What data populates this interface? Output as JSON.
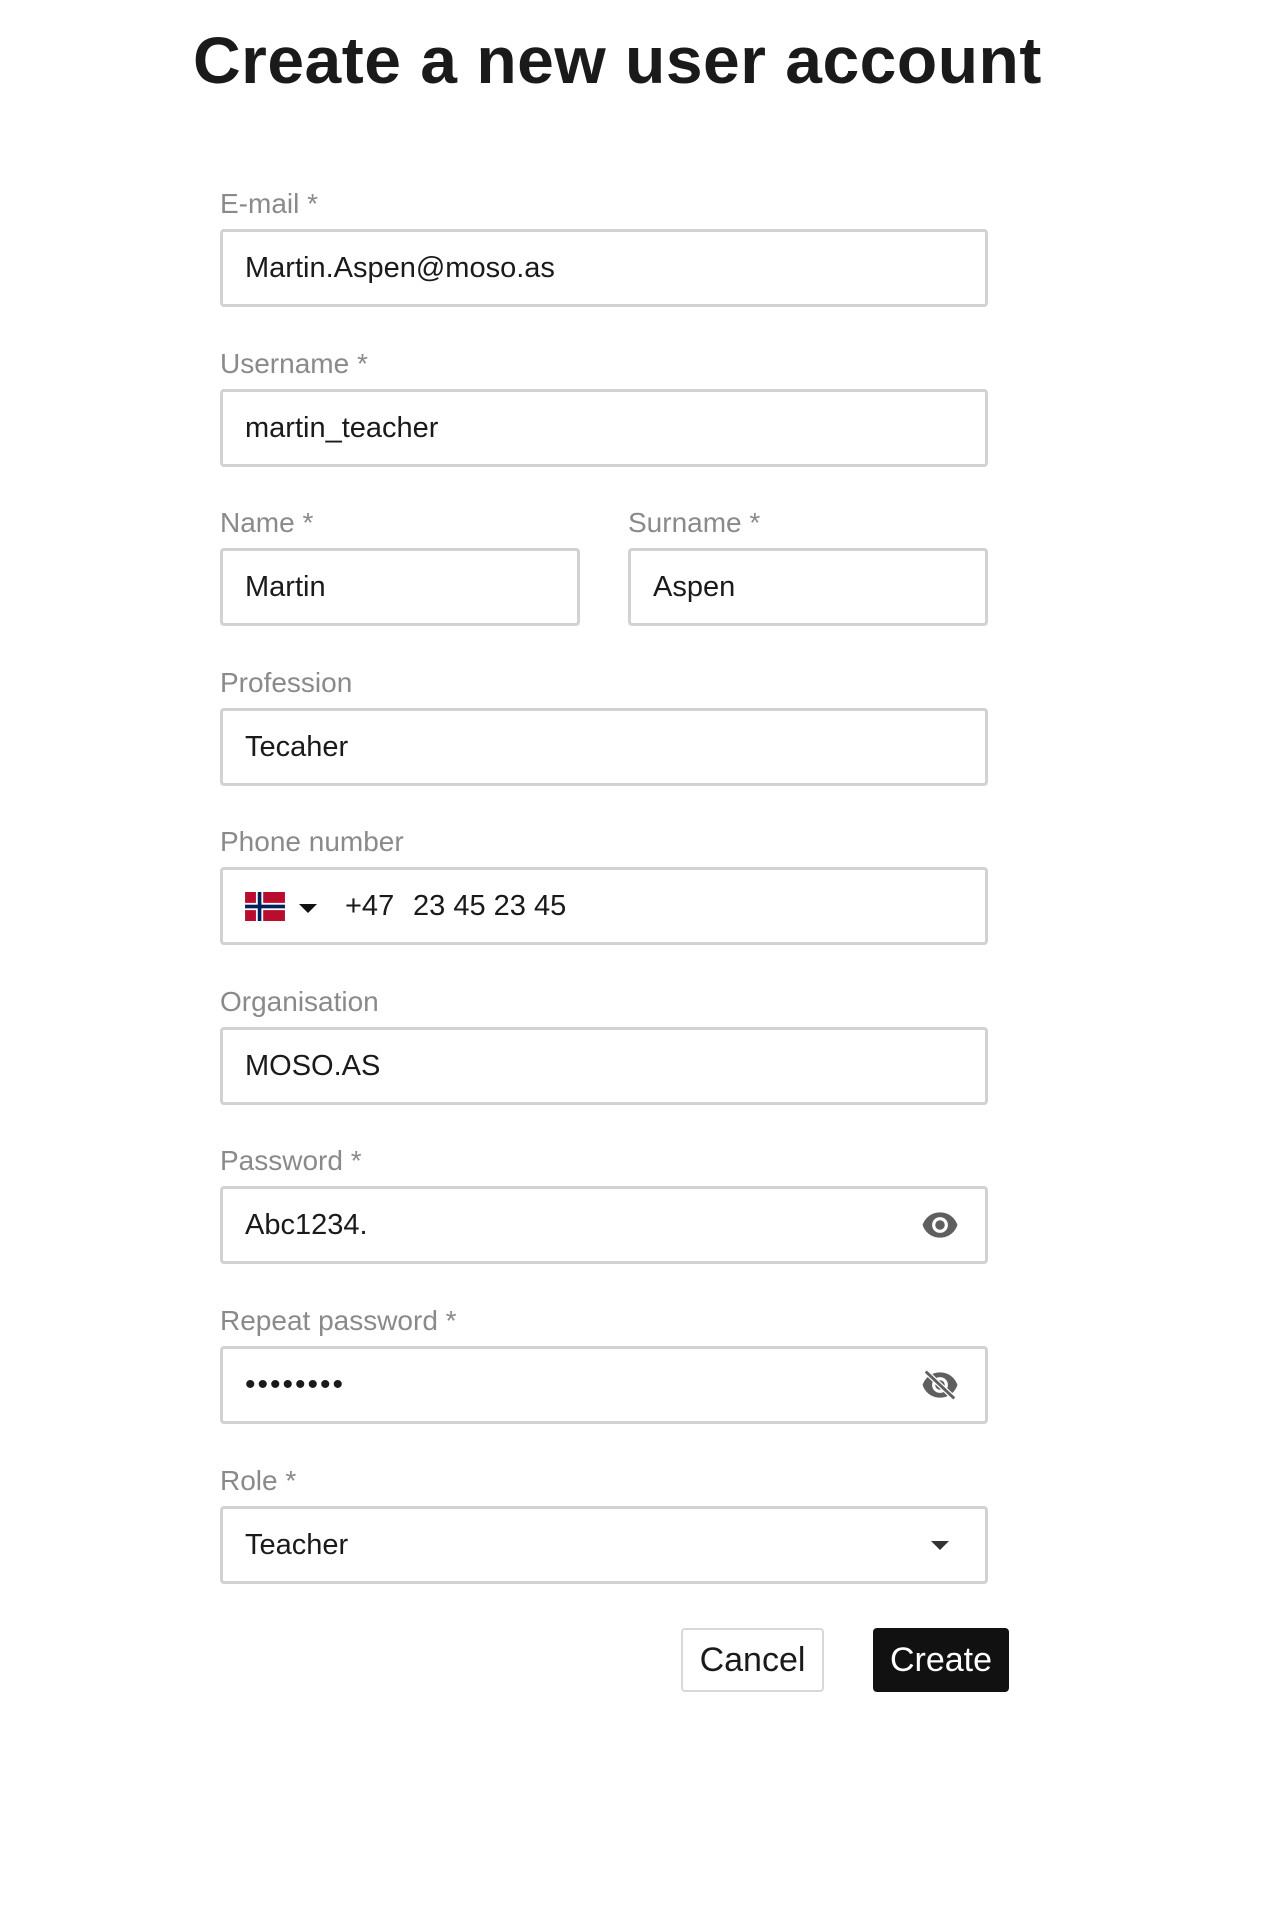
{
  "page": {
    "title": "Create a new user account"
  },
  "form": {
    "email": {
      "label": "E-mail *",
      "value": "Martin.Aspen@moso.as"
    },
    "username": {
      "label": "Username *",
      "value": "martin_teacher"
    },
    "name": {
      "label": "Name *",
      "value": "Martin"
    },
    "surname": {
      "label": "Surname *",
      "value": "Aspen"
    },
    "profession": {
      "label": "Profession",
      "value": "Tecaher"
    },
    "phone": {
      "label": "Phone number",
      "country_flag": "norway-flag-icon",
      "dial_code": "+47",
      "value": "23 45 23 45"
    },
    "organisation": {
      "label": "Organisation",
      "value": "MOSO.AS"
    },
    "password": {
      "label": "Password *",
      "value": "Abc1234.",
      "toggle_icon": "eye-icon"
    },
    "repeat_password": {
      "label": "Repeat password *",
      "masked_value": "••••••••",
      "toggle_icon": "eye-off-icon"
    },
    "role": {
      "label": "Role *",
      "selected": "Teacher"
    }
  },
  "actions": {
    "cancel_label": "Cancel",
    "create_label": "Create"
  },
  "colors": {
    "label": "#8a8a8a",
    "border": "#d2d2d2",
    "primary_button": "#111111",
    "flag_red": "#ba0c2f",
    "flag_blue": "#00205b"
  }
}
